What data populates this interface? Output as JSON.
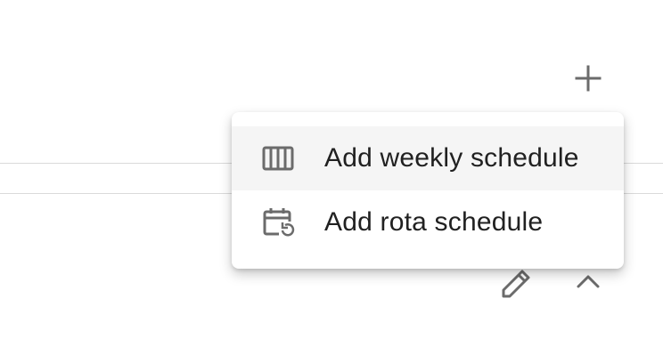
{
  "toolbar": {
    "add_icon": "plus-icon"
  },
  "menu": {
    "items": [
      {
        "label": "Add weekly schedule",
        "icon": "weekly-calendar-icon",
        "highlighted": true
      },
      {
        "label": "Add rota schedule",
        "icon": "rota-calendar-icon",
        "highlighted": false
      }
    ]
  },
  "row_actions": {
    "edit_icon": "pencil-icon",
    "collapse_icon": "chevron-up-icon"
  },
  "colors": {
    "icon": "#6b6b6b",
    "text": "#212121",
    "divider": "#dadada",
    "highlight": "#f5f5f5"
  }
}
